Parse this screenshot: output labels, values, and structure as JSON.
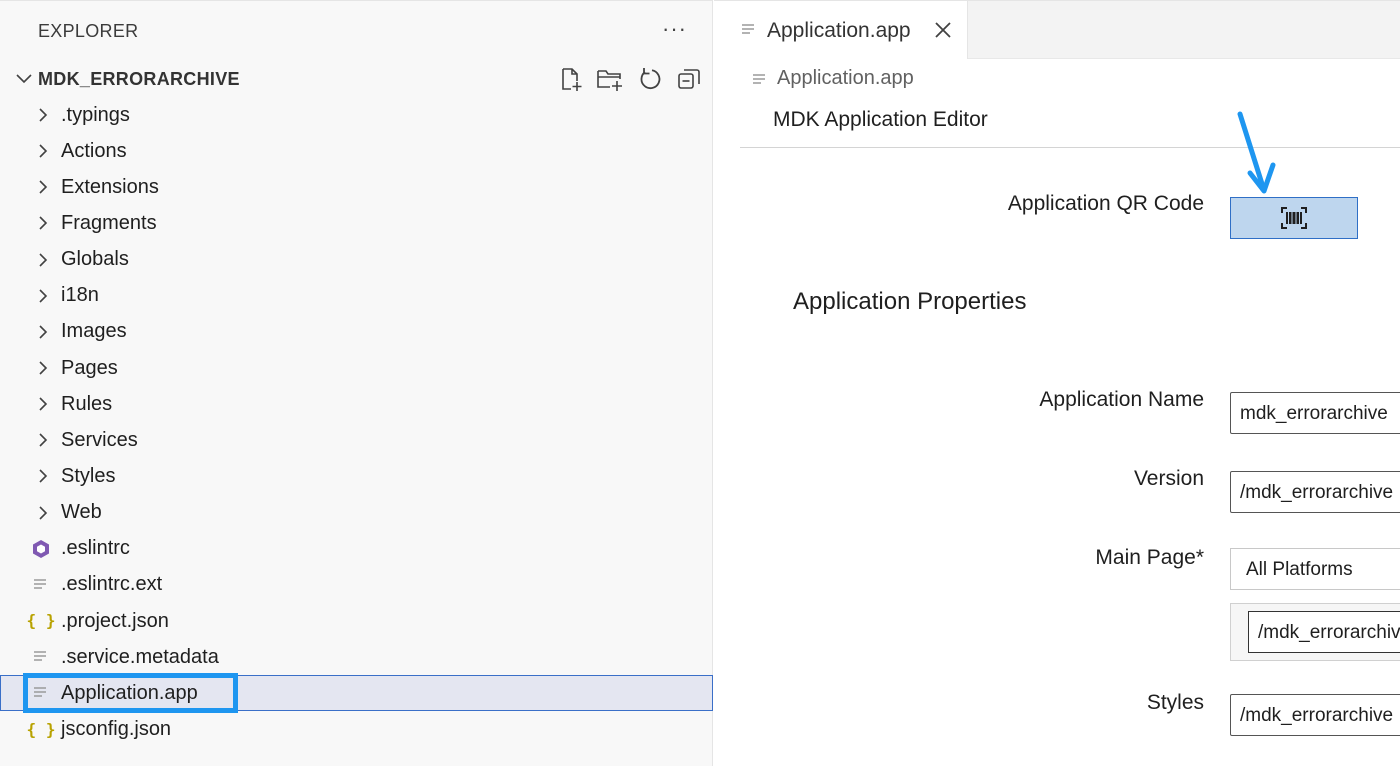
{
  "explorer": {
    "title": "EXPLORER",
    "more_label": "···",
    "project": {
      "name": "MDK_ERRORARCHIVE",
      "actions": [
        "new-file-icon",
        "new-folder-icon",
        "refresh-icon",
        "collapse-all-icon"
      ]
    },
    "folders": [
      ".typings",
      "Actions",
      "Extensions",
      "Fragments",
      "Globals",
      "i18n",
      "Images",
      "Pages",
      "Rules",
      "Services",
      "Styles",
      "Web"
    ],
    "files": [
      {
        "label": ".eslintrc",
        "icon": "eslint-icon"
      },
      {
        "label": ".eslintrc.ext",
        "icon": "text-file-icon"
      },
      {
        "label": ".project.json",
        "icon": "json-icon"
      },
      {
        "label": ".service.metadata",
        "icon": "text-file-icon"
      },
      {
        "label": "Application.app",
        "icon": "text-file-icon",
        "selected": true
      },
      {
        "label": "jsconfig.json",
        "icon": "json-icon"
      }
    ]
  },
  "editor": {
    "tab": {
      "label": "Application.app",
      "close": "×"
    },
    "breadcrumb": "Application.app",
    "title": "MDK Application Editor",
    "qr": {
      "label": "Application QR Code",
      "icon": "barcode-icon"
    },
    "section_title": "Application Properties",
    "fields": {
      "app_name": {
        "label": "Application Name",
        "value": "mdk_errorarchive"
      },
      "version": {
        "label": "Version",
        "value": "/mdk_errorarchive"
      },
      "main_page": {
        "label": "Main Page*",
        "platform": "All Platforms",
        "value": "/mdk_errorarchive"
      },
      "styles": {
        "label": "Styles",
        "value": "/mdk_errorarchive"
      }
    }
  },
  "colors": {
    "highlight": "#1e96f0",
    "qr_button_bg": "#bed6ee",
    "json_icon": "#b8a200",
    "eslint_icon": "#8059b2"
  }
}
